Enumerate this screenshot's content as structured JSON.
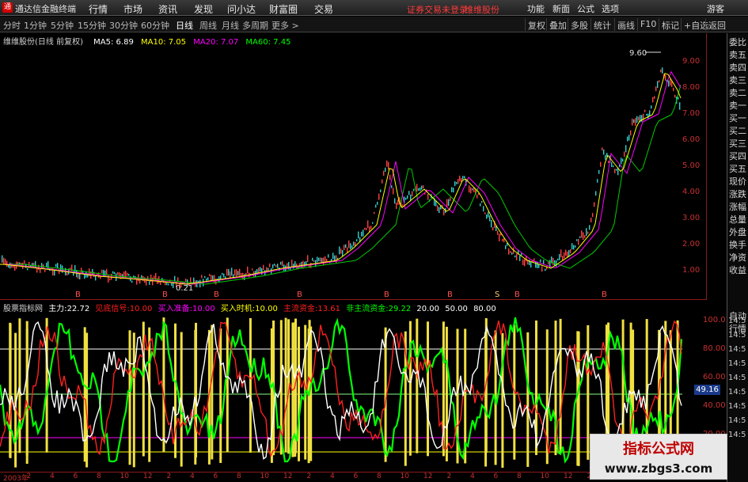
{
  "titlebar": {
    "app_title": "通达信金融终端",
    "logo": "通",
    "menus": [
      "行情",
      "市场",
      "资讯",
      "发现",
      "问小达",
      "财富圈",
      "交易"
    ],
    "alert1": "证券交易未登录",
    "alert2": "维维股份",
    "right": [
      "功能",
      "新面",
      "公式",
      "选项",
      "游客"
    ],
    "window_controls": [
      "_",
      "□",
      "×"
    ]
  },
  "tabs": {
    "periods": [
      "分时",
      "1分钟",
      "5分钟",
      "15分钟",
      "30分钟",
      "60分钟",
      "日线",
      "周线",
      "月线",
      "多周期",
      "更多 >"
    ],
    "active": "日线",
    "buttons": [
      "复权",
      "叠加",
      "多股",
      "统计",
      "画线",
      "F10",
      "标记",
      "+自选",
      "返回"
    ]
  },
  "main_legend": {
    "name": "维维股份(日线 前复权)",
    "ma5": "MA5: 6.89",
    "ma10": "MA10: 7.05",
    "ma20": "MA20: 7.07",
    "ma60": "MA60: 7.45",
    "colors": {
      "ma5": "#ffffff",
      "ma10": "#ffff00",
      "ma20": "#ff00ff",
      "ma60": "#00ff00"
    }
  },
  "main_chart": {
    "high_label": "9.60",
    "low_label": "0.21",
    "price_ticks": [
      "9.00",
      "8.00",
      "7.00",
      "6.00",
      "5.00",
      "4.00",
      "3.00",
      "2.00",
      "1.00"
    ],
    "markers": [
      "B",
      "B",
      "B",
      "B",
      "B",
      "B",
      "B",
      "S",
      "B"
    ]
  },
  "side_panel": [
    "委比",
    "卖五",
    "卖四",
    "卖三",
    "卖二",
    "卖一",
    "买一",
    "买二",
    "买三",
    "买四",
    "买五",
    "现价",
    "涨跌",
    "涨幅",
    "总量",
    "外盘",
    "换手",
    "净资",
    "收益",
    "自动",
    "行情"
  ],
  "side_times": [
    "14:5",
    "14:5",
    "14:5",
    "14:5",
    "14:5",
    "14:5",
    "14:5",
    "14:5",
    "14:5"
  ],
  "sub_legend": {
    "name": "股票指标网",
    "main_force_label": "主力:",
    "main_force": "22.72",
    "signal_label": "见底信号:",
    "signal": "10.00",
    "prepare_label": "买入准备:",
    "prepare": "10.00",
    "timing_label": "买入时机:",
    "timing": "10.00",
    "capital_label": "主流资金:",
    "capital": "13.61",
    "noncap_label": "非主流资金:",
    "noncap": "29.22",
    "v1": "20.00",
    "v2": "50.00",
    "v3": "80.00",
    "colors": {
      "main": "#ffffff",
      "signal": "#ff2020",
      "prepare": "#ff00ff",
      "timing": "#ffff00",
      "capital": "#ff2020",
      "noncap": "#00ff00"
    }
  },
  "sub_chart": {
    "ticks": [
      "100.0",
      "80.00",
      "60.00",
      "40.00",
      "20.00"
    ],
    "current": "49.16"
  },
  "date_axis": [
    "2003年",
    "2",
    "4",
    "6",
    "8",
    "10",
    "12",
    "2",
    "4",
    "6",
    "8",
    "10",
    "12",
    "2",
    "4",
    "6",
    "8",
    "10",
    "12",
    "2",
    "4",
    "6",
    "8",
    "10",
    "12",
    "2",
    "4",
    "6",
    "8",
    "10"
  ],
  "watermark": {
    "line1": "指标公式网",
    "line2": "www.zbgs3.com"
  }
}
